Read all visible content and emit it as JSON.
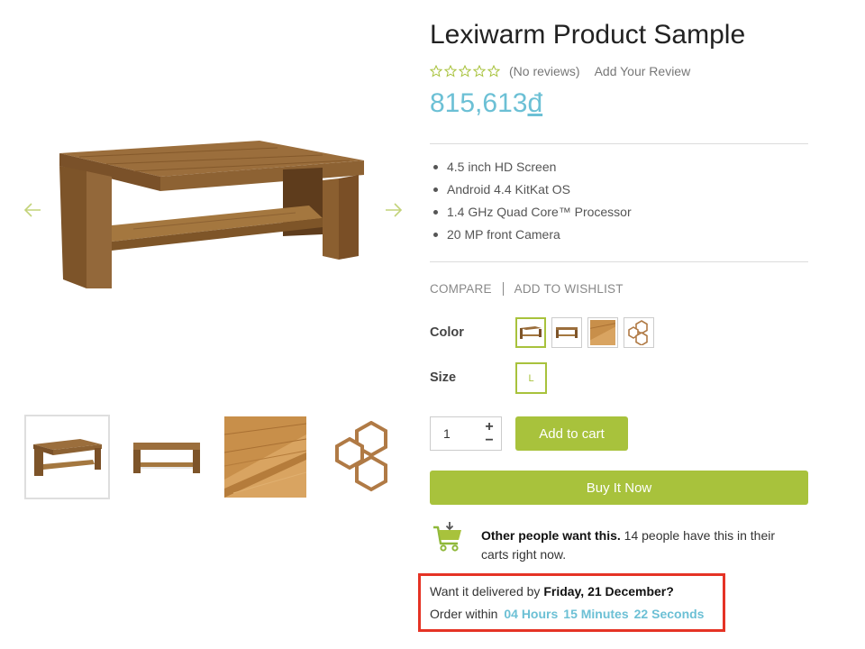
{
  "product": {
    "title": "Lexiwarm Product Sample",
    "rating": {
      "stars": 0,
      "max_stars": 5,
      "no_reviews": "(No reviews)",
      "add_review": "Add Your Review"
    },
    "price": {
      "amount": "815,613",
      "currency": "đ"
    },
    "features": [
      "4.5 inch HD Screen",
      "Android 4.4 KitKat OS",
      "1.4 GHz Quad Core™ Processor",
      "20 MP front Camera"
    ]
  },
  "gallery": {
    "arrow_prev": "arrow-left-icon",
    "arrow_next": "arrow-right-icon",
    "thumbnails": [
      "coffee-table-angle",
      "coffee-table-front",
      "wood-texture",
      "hexagon-shelves"
    ],
    "selected_thumbnail": 0
  },
  "links": {
    "compare": "COMPARE",
    "wishlist": "ADD TO WISHLIST"
  },
  "options": {
    "color_label": "Color",
    "color_swatches": [
      "coffee-table-angle",
      "coffee-table-front",
      "wood-texture",
      "hexagon-shelves"
    ],
    "selected_color": 0,
    "size_label": "Size",
    "size_value": "L"
  },
  "cart": {
    "quantity": "1",
    "plus": "+",
    "minus": "−",
    "add_to_cart": "Add to cart",
    "buy_now": "Buy It Now"
  },
  "social_proof": {
    "icon": "shopping-cart-icon",
    "bold": "Other people want this.",
    "text": " 14 people have this in their carts right now."
  },
  "delivery": {
    "prefix": "Want it delivered by ",
    "date": "Friday, 21 December?",
    "order_within": "Order within",
    "hours": "04 Hours",
    "minutes": "15 Minutes",
    "seconds": "22 Seconds"
  },
  "colors": {
    "accent": "#a8c23c",
    "price": "#6cc0d5",
    "highlight_border": "#e53325"
  }
}
